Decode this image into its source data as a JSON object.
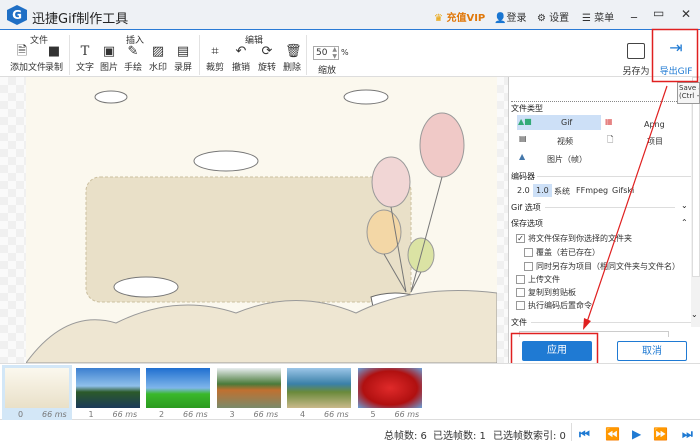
{
  "app": {
    "title": "迅捷Gif制作工具",
    "logo_letter": "G"
  },
  "titlebar": {
    "vip": "充值VIP",
    "login": "登录",
    "settings": "设置",
    "menu": "菜单",
    "minimize": "_",
    "maximize": "▭",
    "close": "✕"
  },
  "toolbar": {
    "groups": {
      "file": "文件",
      "insert": "插入",
      "edit": "编辑"
    },
    "tools": {
      "add_file": "添加文件",
      "record": "录制",
      "text": "文字",
      "image": "图片",
      "draw": "手绘",
      "watermark": "水印",
      "screen_record": "录屏",
      "crop": "裁剪",
      "undo": "撤销",
      "rotate": "旋转",
      "delete": "删除"
    },
    "zoom_value": "50",
    "zoom_unit": "%",
    "zoom_label": "缩放",
    "save_as": "另存为",
    "export_gif": "导出GIF"
  },
  "tooltip": {
    "line1": "Save a",
    "line2": "(Ctrl +"
  },
  "panel": {
    "file_type_title": "文件类型",
    "types": [
      "Gif",
      "Apng",
      "视频",
      "项目",
      "图片（帧）"
    ],
    "encoder_title": "编码器",
    "encoders": [
      "2.0",
      "1.0",
      "系统",
      "FFmpeg",
      "Gifski"
    ],
    "gif_options": "Gif 选项",
    "save_options": "保存选项",
    "save_items": [
      {
        "label": "将文件保存到你选择的文件夹",
        "checked": true
      },
      {
        "label": "覆盖（若已存在）",
        "checked": false
      },
      {
        "label": "同时另存为项目（相同文件夹与文件名）",
        "checked": false
      },
      {
        "label": "上传文件",
        "checked": false
      },
      {
        "label": "复制到剪贴板",
        "checked": false
      },
      {
        "label": "执行编码后置命令",
        "checked": false
      }
    ],
    "file_title": "文件",
    "apply": "应用",
    "cancel": "取消"
  },
  "frames": [
    {
      "index": "0",
      "delay": "66 ms"
    },
    {
      "index": "1",
      "delay": "66 ms"
    },
    {
      "index": "2",
      "delay": "66 ms"
    },
    {
      "index": "3",
      "delay": "66 ms"
    },
    {
      "index": "4",
      "delay": "66 ms"
    },
    {
      "index": "5",
      "delay": "66 ms"
    }
  ],
  "status": {
    "total": "总帧数: 6",
    "selected": "已选帧数: 1",
    "selected_index": "已选帧数索引: 0"
  },
  "colors": {
    "accent": "#1f7ad3",
    "annotation": "#e02020"
  }
}
